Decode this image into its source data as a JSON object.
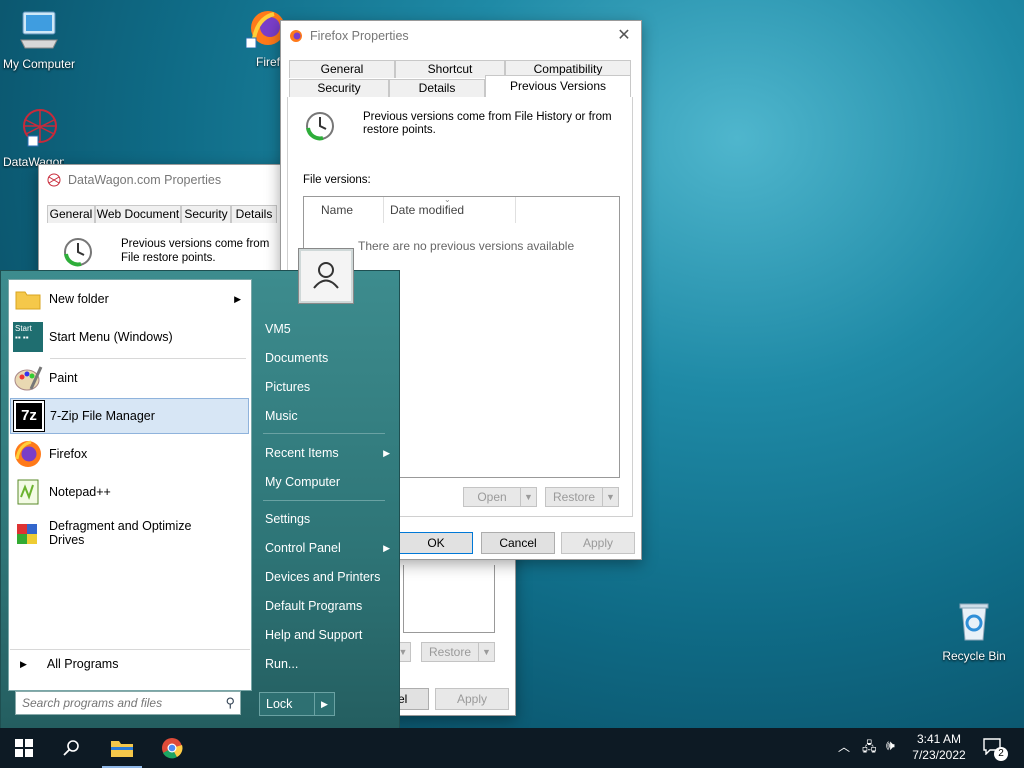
{
  "desktop": {
    "icons": [
      {
        "label": "My Computer"
      },
      {
        "label": "Firefox"
      },
      {
        "label": "DataWagon.com"
      },
      {
        "label": "Recycle Bin"
      }
    ]
  },
  "ff_props": {
    "title": "Firefox Properties",
    "tabs_top": [
      "General",
      "Shortcut",
      "Compatibility"
    ],
    "tabs_bottom": [
      "Security",
      "Details",
      "Previous Versions"
    ],
    "info": "Previous versions come from File History or from restore points.",
    "file_versions_label": "File versions:",
    "columns": [
      "Name",
      "Date modified"
    ],
    "empty": "There are no previous versions available",
    "open": "Open",
    "restore": "Restore",
    "ok": "OK",
    "cancel": "Cancel",
    "apply": "Apply"
  },
  "dw_props": {
    "title": "DataWagon.com Properties",
    "tabs": [
      "General",
      "Web Document",
      "Security",
      "Details"
    ],
    "info": "Previous versions come from File restore points.",
    "restore": "Restore",
    "cancel_partial": "el",
    "apply": "Apply"
  },
  "start_menu": {
    "left_items": [
      {
        "label": "New folder"
      },
      {
        "label": "Start Menu (Windows)"
      },
      {
        "label": "Paint"
      },
      {
        "label": "7-Zip File Manager"
      },
      {
        "label": "Firefox"
      },
      {
        "label": "Notepad++"
      },
      {
        "label": "Defragment and Optimize Drives"
      }
    ],
    "all_programs": "All Programs",
    "search_placeholder": "Search programs and files",
    "right_items": [
      "VM5",
      "Documents",
      "Pictures",
      "Music",
      "Recent Items",
      "My Computer",
      "Settings",
      "Control Panel",
      "Devices and Printers",
      "Default Programs",
      "Help and Support",
      "Run..."
    ],
    "lock": "Lock"
  },
  "taskbar": {
    "time": "3:41 AM",
    "date": "7/23/2022",
    "notifications": "2"
  }
}
